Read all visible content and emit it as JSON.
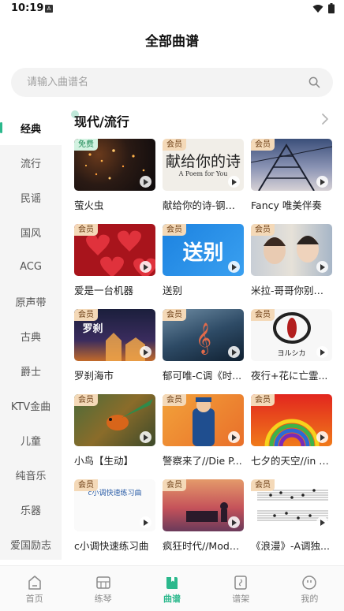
{
  "status": {
    "time": "10:19",
    "notif": "A"
  },
  "header": {
    "title": "全部曲谱"
  },
  "search": {
    "placeholder": "请输入曲谱名"
  },
  "colors": {
    "accent": "#2bb88c",
    "vip_badge": "#f4d9b8",
    "free_badge": "#d3f2e1"
  },
  "sidebar": {
    "items": [
      {
        "label": "经典",
        "active": true
      },
      {
        "label": "流行"
      },
      {
        "label": "民谣"
      },
      {
        "label": "国风"
      },
      {
        "label": "ACG"
      },
      {
        "label": "原声带"
      },
      {
        "label": "古典"
      },
      {
        "label": "爵士"
      },
      {
        "label": "KTV金曲"
      },
      {
        "label": "儿童"
      },
      {
        "label": "纯音乐"
      },
      {
        "label": "乐器"
      },
      {
        "label": "爱国励志"
      }
    ]
  },
  "section": {
    "title": "现代/流行"
  },
  "cards": [
    {
      "title": "萤火虫",
      "badge": "免费"
    },
    {
      "title": "献给你的诗-钢琴...",
      "badge": "会员",
      "thumb_title": "献给你的诗",
      "thumb_sub": "A Poem for You"
    },
    {
      "title": "Fancy 唯美伴奏",
      "badge": "会员"
    },
    {
      "title": "爱是一台机器",
      "badge": "会员"
    },
    {
      "title": "送别",
      "badge": "会员",
      "thumb_title": "送别"
    },
    {
      "title": "米拉-哥哥你别跑...",
      "badge": "会员"
    },
    {
      "title": "罗刹海市",
      "badge": "会员",
      "thumb_title": "罗刹"
    },
    {
      "title": "郁可唯-C调《时...",
      "badge": "会员"
    },
    {
      "title": "夜行+花に亡霊...",
      "badge": "会员",
      "thumb_title": "ヨルシカ"
    },
    {
      "title": "小鸟【生动】",
      "badge": "会员"
    },
    {
      "title": "警察来了//Die P...",
      "badge": "会员"
    },
    {
      "title": "七夕的天空//in s...",
      "badge": "会员"
    },
    {
      "title": "c小调快速练习曲",
      "badge": "会员",
      "thumb_title": "c小调快速练习曲"
    },
    {
      "title": "疯狂时代//Mode...",
      "badge": "会员"
    },
    {
      "title": "《浪漫》-A调独...",
      "badge": "会员"
    }
  ],
  "bottom_nav": [
    {
      "label": "首页",
      "icon": "home-icon"
    },
    {
      "label": "练琴",
      "icon": "piano-icon"
    },
    {
      "label": "曲谱",
      "icon": "score-book-icon",
      "active": true
    },
    {
      "label": "谱架",
      "icon": "music-stand-icon"
    },
    {
      "label": "我的",
      "icon": "profile-icon"
    }
  ]
}
